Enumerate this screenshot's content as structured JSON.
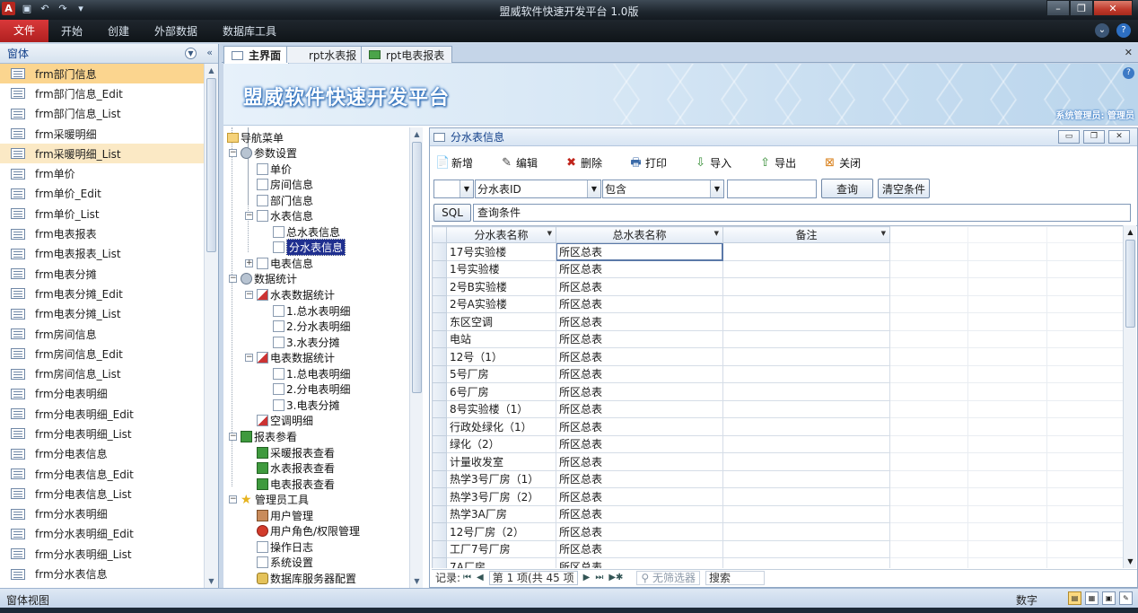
{
  "app": {
    "title": "盟威软件快速开发平台 1.0版",
    "icon_letter": "A"
  },
  "ribbon": {
    "file": "文件",
    "tabs": [
      "开始",
      "创建",
      "外部数据",
      "数据库工具"
    ]
  },
  "navpane": {
    "title": "窗体",
    "items": [
      "frm部门信息",
      "frm部门信息_Edit",
      "frm部门信息_List",
      "frm采暖明细",
      "frm采暖明细_List",
      "frm单价",
      "frm单价_Edit",
      "frm单价_List",
      "frm电表报表",
      "frm电表报表_List",
      "frm电表分摊",
      "frm电表分摊_Edit",
      "frm电表分摊_List",
      "frm房间信息",
      "frm房间信息_Edit",
      "frm房间信息_List",
      "frm分电表明细",
      "frm分电表明细_Edit",
      "frm分电表明细_List",
      "frm分电表信息",
      "frm分电表信息_Edit",
      "frm分电表信息_List",
      "frm分水表明细",
      "frm分水表明细_Edit",
      "frm分水表明细_List",
      "frm分水表信息"
    ],
    "selected_index": 0,
    "hover_index": 4
  },
  "doctabs": [
    "主界面",
    "rpt水表报",
    "rpt电表报表"
  ],
  "banner": {
    "title": "盟威软件快速开发平台",
    "user": "系统管理员: 管理员"
  },
  "tree": [
    {
      "label": "导航菜单",
      "level": 0,
      "icon": "folder-icon"
    },
    {
      "label": "参数设置",
      "level": 1,
      "icon": "gear-icon",
      "toggle": "−"
    },
    {
      "label": "单价",
      "level": 2,
      "icon": "doc-icon"
    },
    {
      "label": "房间信息",
      "level": 2,
      "icon": "doc-icon"
    },
    {
      "label": "部门信息",
      "level": 2,
      "icon": "doc-icon"
    },
    {
      "label": "水表信息",
      "level": 2,
      "icon": "doc-icon",
      "toggle": "−"
    },
    {
      "label": "总水表信息",
      "level": 3,
      "icon": "doc-icon"
    },
    {
      "label": "分水表信息",
      "level": 3,
      "icon": "doc-icon",
      "selected": true
    },
    {
      "label": "电表信息",
      "level": 2,
      "icon": "doc-icon",
      "toggle": "+"
    },
    {
      "label": "数据统计",
      "level": 1,
      "icon": "gear-icon",
      "toggle": "−"
    },
    {
      "label": "水表数据统计",
      "level": 2,
      "icon": "chart-icon",
      "toggle": "−"
    },
    {
      "label": "1.总水表明细",
      "level": 3,
      "icon": "doc-icon"
    },
    {
      "label": "2.分水表明细",
      "level": 3,
      "icon": "doc-icon"
    },
    {
      "label": "3.水表分摊",
      "level": 3,
      "icon": "doc-icon"
    },
    {
      "label": "电表数据统计",
      "level": 2,
      "icon": "chart-icon",
      "toggle": "−"
    },
    {
      "label": "1.总电表明细",
      "level": 3,
      "icon": "doc-icon"
    },
    {
      "label": "2.分电表明细",
      "level": 3,
      "icon": "doc-icon"
    },
    {
      "label": "3.电表分摊",
      "level": 3,
      "icon": "doc-icon"
    },
    {
      "label": "空调明细",
      "level": 2,
      "icon": "chart-icon"
    },
    {
      "label": "报表参看",
      "level": 1,
      "icon": "report-icon",
      "toggle": "−"
    },
    {
      "label": "采暖报表查看",
      "level": 2,
      "icon": "report-icon"
    },
    {
      "label": "水表报表查看",
      "level": 2,
      "icon": "report-icon"
    },
    {
      "label": "电表报表查看",
      "level": 2,
      "icon": "report-icon"
    },
    {
      "label": "管理员工具",
      "level": 1,
      "icon": "star-icon",
      "toggle": "−"
    },
    {
      "label": "用户管理",
      "level": 2,
      "icon": "users-icon"
    },
    {
      "label": "用户角色/权限管理",
      "level": 2,
      "icon": "role-icon"
    },
    {
      "label": "操作日志",
      "level": 2,
      "icon": "doc-icon"
    },
    {
      "label": "系统设置",
      "level": 2,
      "icon": "settings-icon"
    },
    {
      "label": "数据库服务器配置",
      "level": 2,
      "icon": "database-icon"
    }
  ],
  "subform": {
    "title": "分水表信息",
    "toolbar": [
      {
        "label": "新增",
        "icon": "new-icon",
        "glyph": "📄"
      },
      {
        "label": "编辑",
        "icon": "edit-icon",
        "glyph": "✎"
      },
      {
        "label": "删除",
        "icon": "delete-icon",
        "glyph": "✖"
      },
      {
        "label": "打印",
        "icon": "print-icon",
        "glyph": "🖶"
      },
      {
        "label": "导入",
        "icon": "import-icon",
        "glyph": "⇩"
      },
      {
        "label": "导出",
        "icon": "export-icon",
        "glyph": "⇧"
      },
      {
        "label": "关闭",
        "icon": "close-icon",
        "glyph": "⊠"
      }
    ],
    "filter": {
      "field": "分水表ID",
      "operator": "包含",
      "value": "",
      "query_btn": "查询",
      "clear_btn": "清空条件",
      "sql_btn": "SQL",
      "condition_label": "查询条件"
    },
    "columns": [
      "分水表名称",
      "总水表名称",
      "备注"
    ],
    "rows": [
      [
        "17号实验楼",
        "所区总表",
        ""
      ],
      [
        "1号实验楼",
        "所区总表",
        ""
      ],
      [
        "2号B实验楼",
        "所区总表",
        ""
      ],
      [
        "2号A实验楼",
        "所区总表",
        ""
      ],
      [
        "东区空调",
        "所区总表",
        ""
      ],
      [
        "电站",
        "所区总表",
        ""
      ],
      [
        "12号（1）",
        "所区总表",
        ""
      ],
      [
        "5号厂房",
        "所区总表",
        ""
      ],
      [
        "6号厂房",
        "所区总表",
        ""
      ],
      [
        "8号实验楼（1）",
        "所区总表",
        ""
      ],
      [
        "行政处绿化（1）",
        "所区总表",
        ""
      ],
      [
        "绿化（2）",
        "所区总表",
        ""
      ],
      [
        "计量收发室",
        "所区总表",
        ""
      ],
      [
        "热学3号厂房（1）",
        "所区总表",
        ""
      ],
      [
        "热学3号厂房（2）",
        "所区总表",
        ""
      ],
      [
        "热学3A厂房",
        "所区总表",
        ""
      ],
      [
        "12号厂房（2）",
        "所区总表",
        ""
      ],
      [
        "工厂7号厂房",
        "所区总表",
        ""
      ],
      [
        "7A厂房",
        "所区总表",
        ""
      ]
    ],
    "recnav": {
      "label": "记录:",
      "current": "第 1 项(共 45 项",
      "nofilter": "无筛选器",
      "search": "搜索"
    }
  },
  "status": {
    "left": "窗体视图",
    "right": "数字"
  }
}
